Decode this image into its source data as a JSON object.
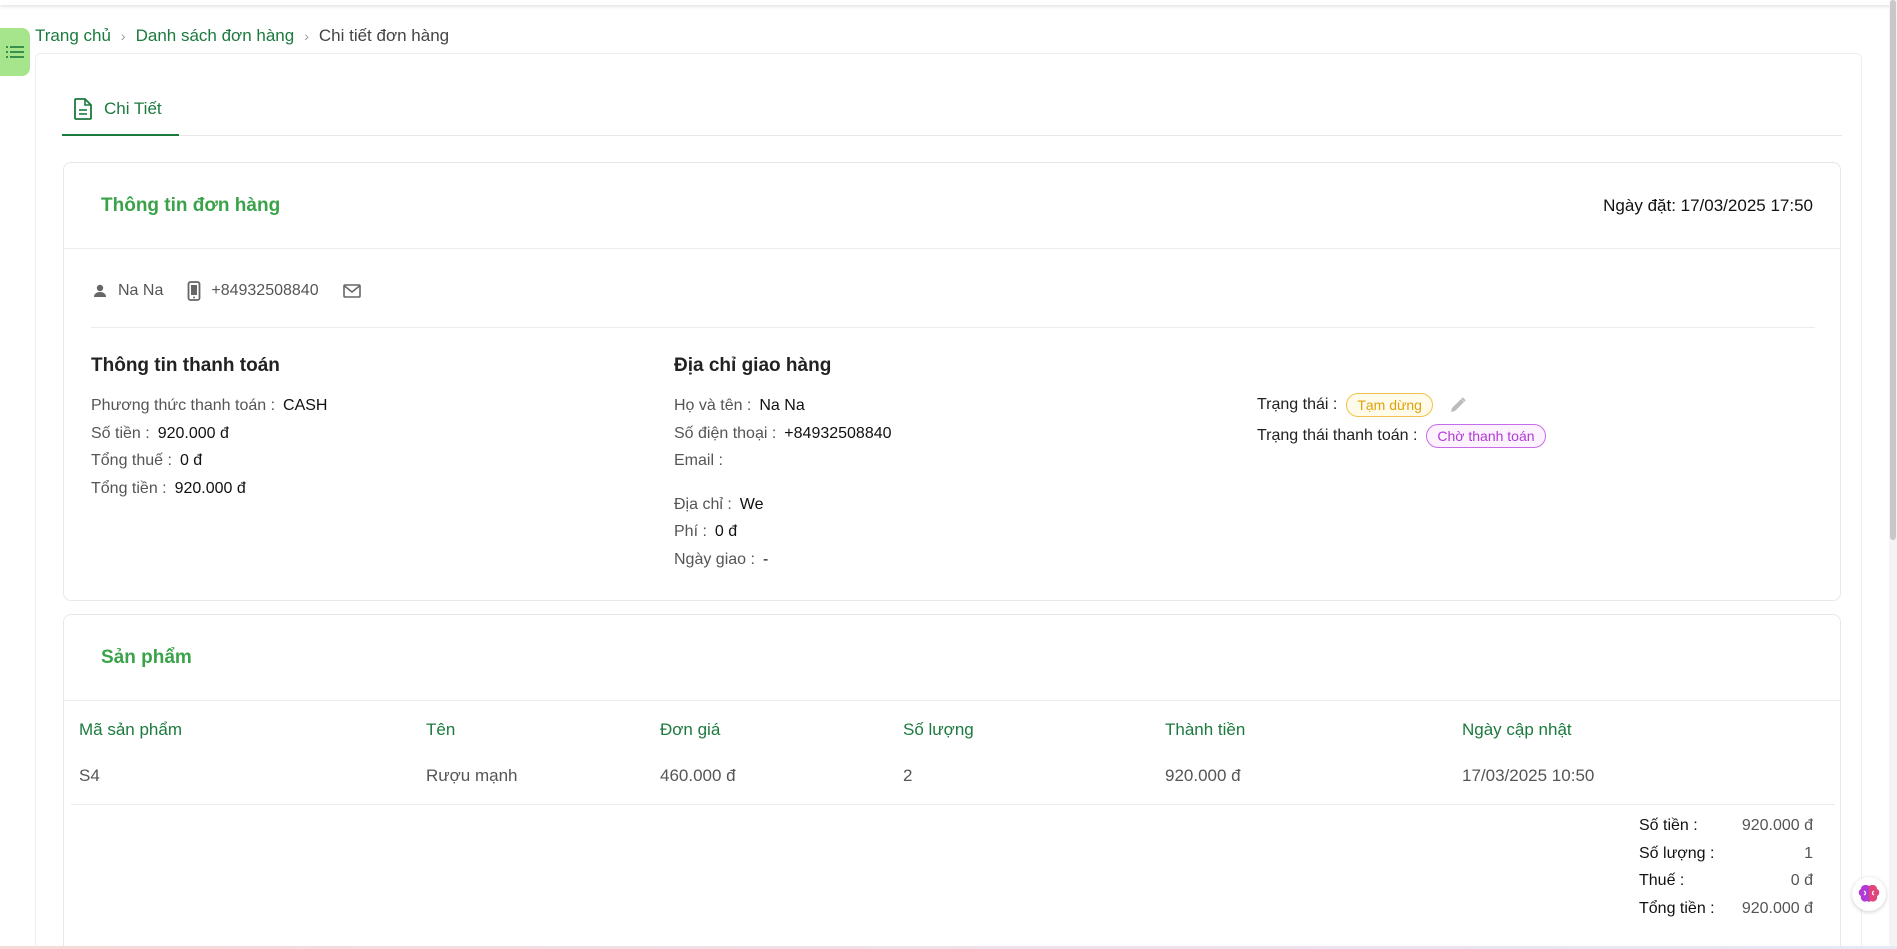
{
  "breadcrumb": {
    "home": "Trang chủ",
    "orders": "Danh sách đơn hàng",
    "current": "Chi tiết đơn hàng"
  },
  "tabs": [
    {
      "label": "Chi Tiết",
      "icon": "document-icon",
      "active": true
    }
  ],
  "order": {
    "title": "Thông tin đơn hàng",
    "date_text": "Ngày đặt: 17/03/2025 17:50",
    "customer": {
      "name": "Na Na",
      "phone": "+84932508840",
      "email_icon": "mail-icon"
    },
    "payment": {
      "title": "Thông tin thanh toán",
      "method_label": "Phương thức thanh toán :",
      "method": "CASH",
      "amount_label": "Số tiền :",
      "amount": "920.000 đ",
      "tax_label": "Tổng thuế :",
      "tax": "0 đ",
      "total_label": "Tổng tiền :",
      "total": "920.000 đ"
    },
    "shipping": {
      "title": "Địa chỉ giao hàng",
      "name_label": "Họ và tên :",
      "name": "Na Na",
      "phone_label": "Số điện thoại :",
      "phone": "+84932508840",
      "email_label": "Email :",
      "email": "",
      "address_label": "Địa chỉ :",
      "address": "We",
      "fee_label": "Phí :",
      "fee": "0 đ",
      "delivery_label": "Ngày giao :",
      "delivery": "-"
    },
    "status": {
      "label": "Trạng thái :",
      "value": "Tạm dừng",
      "color": "#e0a10c",
      "payment_label": "Trạng thái thanh toán :",
      "payment_value": "Chờ thanh toán",
      "payment_color": "#b23ad6"
    }
  },
  "products": {
    "title": "Sản phẩm",
    "columns": [
      "Mã sản phẩm",
      "Tên",
      "Đơn giá",
      "Số lượng",
      "Thành tiền",
      "Ngày cập nhật"
    ],
    "rows": [
      {
        "code": "S4",
        "name": "Rượu mạnh",
        "price": "460.000 đ",
        "qty": "2",
        "amount": "920.000 đ",
        "updated": "17/03/2025 10:50"
      }
    ],
    "summary": {
      "amount_label": "Số tiền :",
      "amount": "920.000 đ",
      "qty_label": "Số lượng :",
      "qty": "1",
      "tax_label": "Thuế :",
      "tax": "0 đ",
      "total_label": "Tổng tiền :",
      "total": "920.000 đ"
    }
  },
  "colors": {
    "accent": "#1b7a3e",
    "section_title": "#3aa34a",
    "menu_toggle": "#a6e58c"
  }
}
